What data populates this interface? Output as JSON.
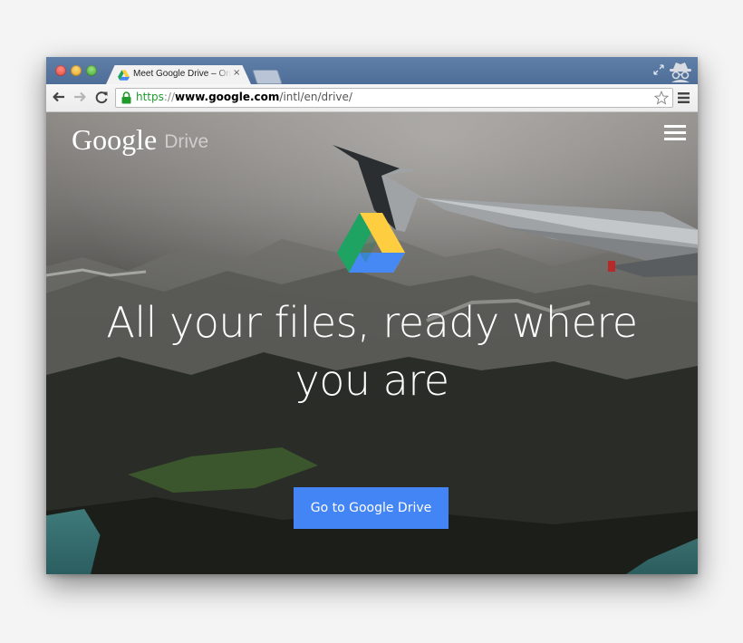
{
  "browser": {
    "tab": {
      "title": "Meet Google Drive – One place for all your files",
      "close_glyph": "×"
    },
    "omnibox": {
      "scheme": "https",
      "separator": "://",
      "host": "www.google.com",
      "path": "/intl/en/drive/"
    },
    "icons": {
      "back": "back-arrow-icon",
      "forward": "forward-arrow-icon",
      "reload": "reload-icon",
      "lock": "lock-icon",
      "star": "star-icon",
      "menu": "menu-icon",
      "incognito": "incognito-icon"
    }
  },
  "page": {
    "brand_google": "Google",
    "brand_product": "Drive",
    "headline": "All your files, ready where you are",
    "cta_label": "Go to Google Drive",
    "colors": {
      "cta": "#4485f5",
      "drive_green": "#1ea362",
      "drive_yellow": "#ffcd40",
      "drive_blue": "#4688f4"
    }
  }
}
